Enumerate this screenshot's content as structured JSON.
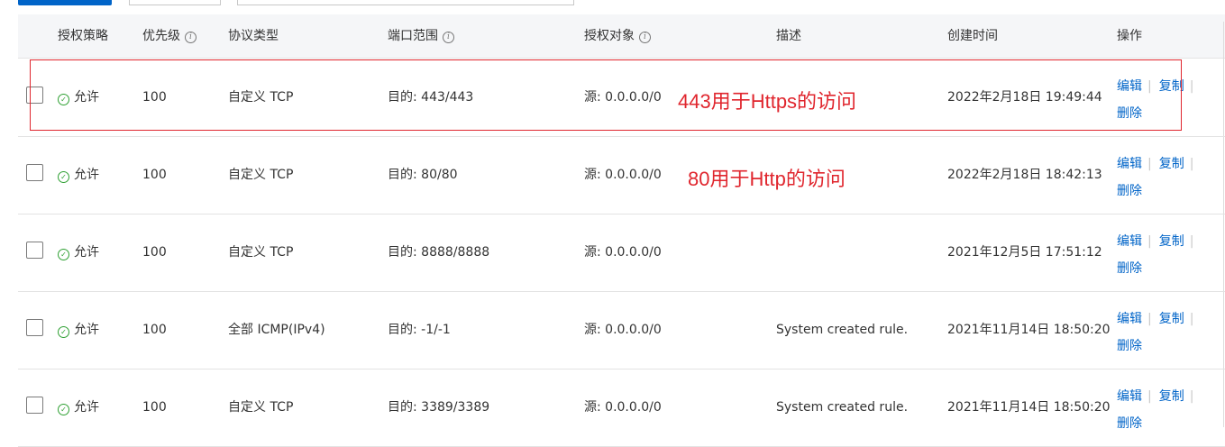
{
  "table": {
    "columns": {
      "policy": "授权策略",
      "priority": "优先级",
      "protocol": "协议类型",
      "port": "端口范围",
      "target": "授权对象",
      "description": "描述",
      "created": "创建时间",
      "operations": "操作"
    },
    "rows": [
      {
        "policy": "允许",
        "priority": "100",
        "protocol": "自定义 TCP",
        "port": "目的: 443/443",
        "target": "源: 0.0.0.0/0",
        "description": "",
        "created": "2022年2月18日 19:49:44",
        "edit": "编辑",
        "copy": "复制",
        "delete": "删除"
      },
      {
        "policy": "允许",
        "priority": "100",
        "protocol": "自定义 TCP",
        "port": "目的: 80/80",
        "target": "源: 0.0.0.0/0",
        "description": "",
        "created": "2022年2月18日 18:42:13",
        "edit": "编辑",
        "copy": "复制",
        "delete": "删除"
      },
      {
        "policy": "允许",
        "priority": "100",
        "protocol": "自定义 TCP",
        "port": "目的: 8888/8888",
        "target": "源: 0.0.0.0/0",
        "description": "",
        "created": "2021年12月5日 17:51:12",
        "edit": "编辑",
        "copy": "复制",
        "delete": "删除"
      },
      {
        "policy": "允许",
        "priority": "100",
        "protocol": "全部 ICMP(IPv4)",
        "port": "目的: -1/-1",
        "target": "源: 0.0.0.0/0",
        "description": "System created rule.",
        "created": "2021年11月14日 18:50:20",
        "edit": "编辑",
        "copy": "复制",
        "delete": "删除"
      },
      {
        "policy": "允许",
        "priority": "100",
        "protocol": "自定义 TCP",
        "port": "目的: 3389/3389",
        "target": "源: 0.0.0.0/0",
        "description": "System created rule.",
        "created": "2021年11月14日 18:50:20",
        "edit": "编辑",
        "copy": "复制",
        "delete": "删除"
      }
    ]
  },
  "annotations": {
    "https_note": "443用于Https的访问",
    "http_note": "80用于Http的访问"
  },
  "icons": {
    "info": "info-circle-icon",
    "allow": "check-circle-icon"
  },
  "colors": {
    "primary": "#0064c8",
    "allow": "#2fa033",
    "annotation": "#e0262e",
    "header_bg": "#f5f6f8"
  }
}
